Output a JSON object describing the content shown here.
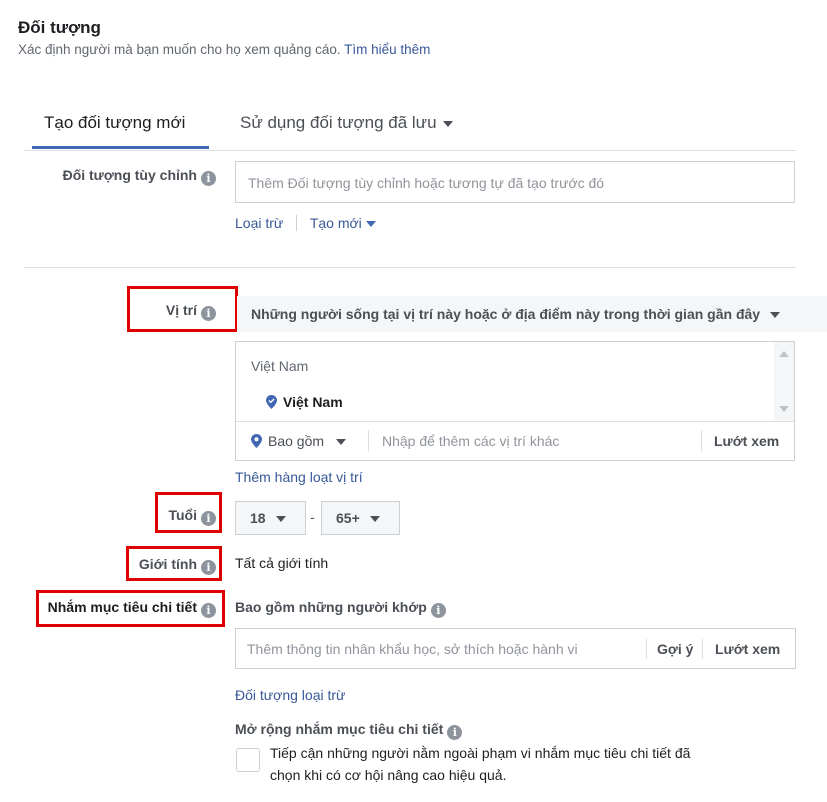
{
  "header": {
    "title": "Đối tượng",
    "subtitle": "Xác định người mà bạn muốn cho họ xem quảng cáo.",
    "learn_more": "Tìm hiểu thêm"
  },
  "tabs": [
    {
      "label": "Tạo đối tượng mới"
    },
    {
      "label": "Sử dụng đối tượng đã lưu"
    }
  ],
  "custom_audience": {
    "label": "Đối tượng tùy chỉnh",
    "placeholder": "Thêm Đối tượng tùy chỉnh hoặc tương tự đã tạo trước đó",
    "exclude": "Loại trừ",
    "create_new": "Tạo mới"
  },
  "location": {
    "label": "Vị trí",
    "dropdown": "Những người sống tại vị trí này hoặc ở địa điểm này trong thời gian gần đây",
    "group_header": "Việt Nam",
    "selected": "Việt Nam",
    "include": "Bao gồm",
    "placeholder": "Nhập để thêm các vị trí khác",
    "browse": "Lướt xem",
    "bulk_add": "Thêm hàng loạt vị trí"
  },
  "age": {
    "label": "Tuổi",
    "min": "18",
    "separator": "-",
    "max": "65+"
  },
  "gender": {
    "label": "Giới tính",
    "value": "Tất cả giới tính"
  },
  "detailed": {
    "label": "Nhắm mục tiêu chi tiết",
    "include_header": "Bao gồm những người khớp",
    "placeholder": "Thêm thông tin nhân khẩu học, sở thích hoặc hành vi",
    "suggest": "Gợi ý",
    "browse": "Lướt xem",
    "exclude": "Đối tượng loại trừ",
    "expand_title": "Mở rộng nhắm mục tiêu chi tiết",
    "expand_line1": "Tiếp cận những người nằm ngoài phạm vi nhắm mục tiêu chi tiết đã",
    "expand_line2": "chọn khi có cơ hội nâng cao hiệu quả."
  },
  "info_glyph": "i",
  "colors": {
    "link": "#385898",
    "accent": "#4267b2",
    "highlight": "#e00000"
  }
}
